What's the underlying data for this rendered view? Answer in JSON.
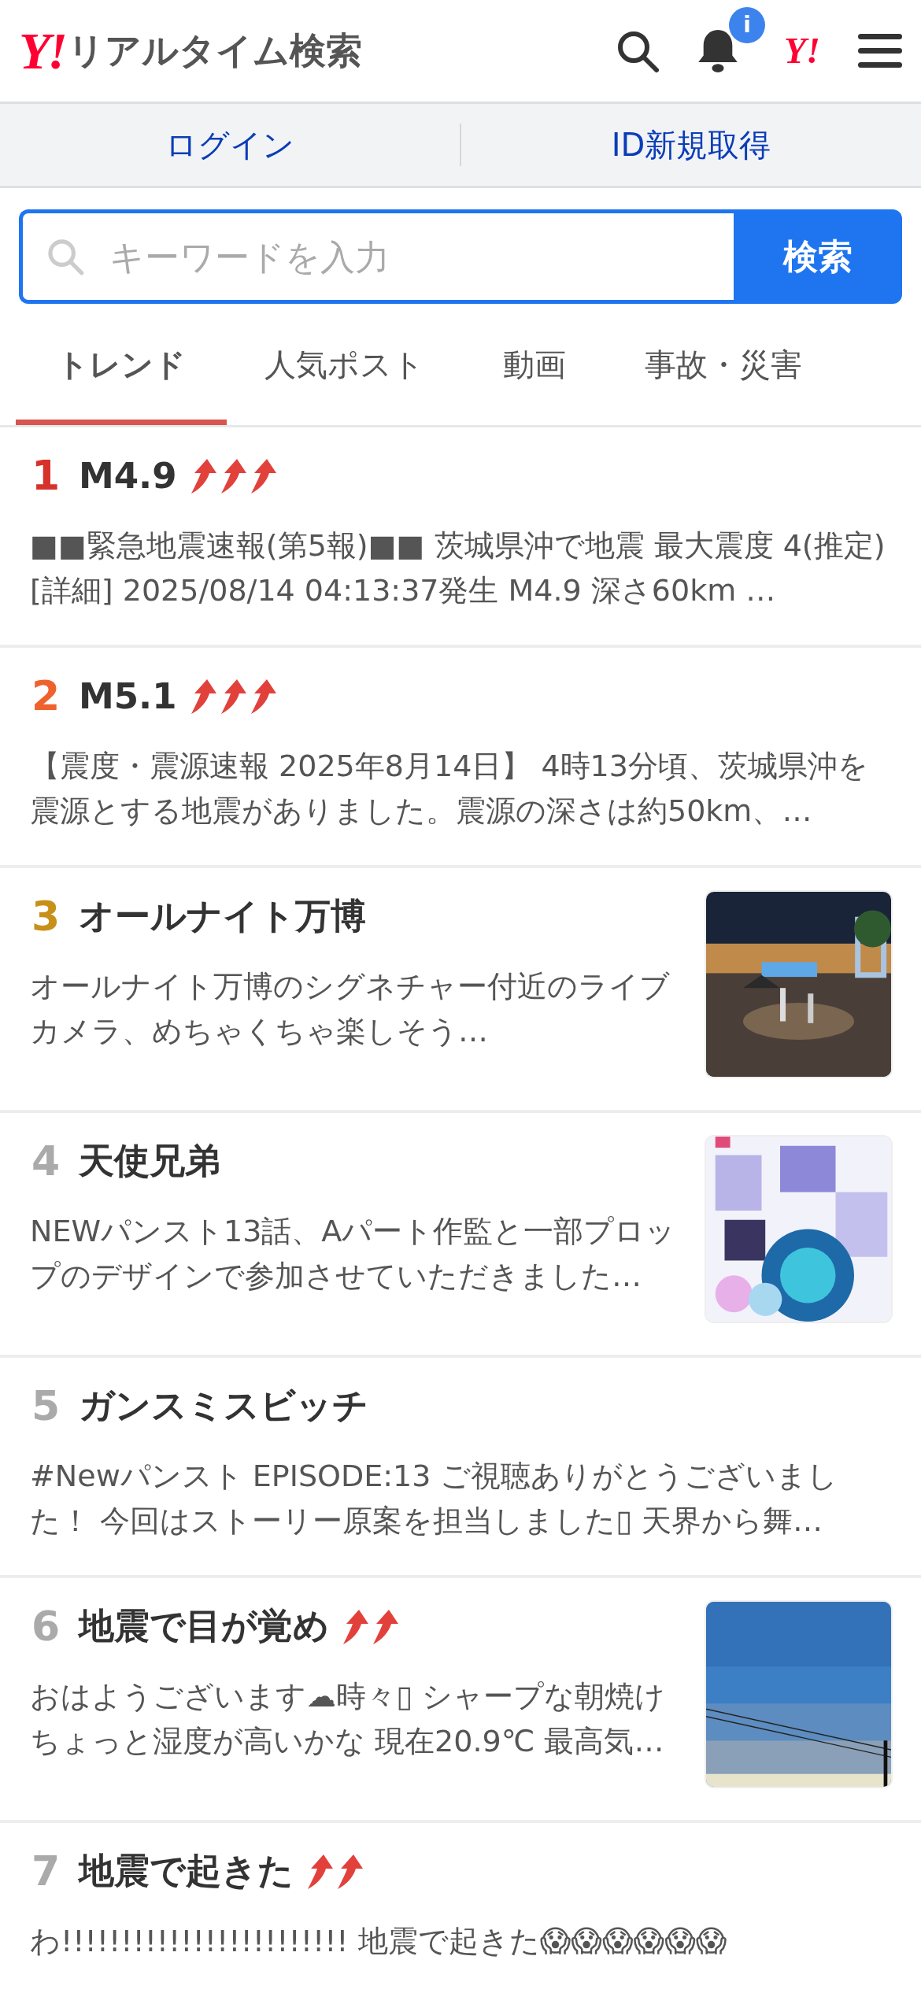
{
  "header": {
    "logo_mark": "Y!",
    "logo_title": "リアルタイム検索",
    "notification_badge": "i",
    "account_mark": "Y!"
  },
  "account_bar": {
    "links": [
      "ログイン",
      "ID新規取得"
    ]
  },
  "search": {
    "placeholder": "キーワードを入力",
    "button": "検索"
  },
  "tabs": [
    {
      "label": "トレンド",
      "selected": true
    },
    {
      "label": "人気ポスト",
      "selected": false
    },
    {
      "label": "動画",
      "selected": false
    },
    {
      "label": "事故・災害",
      "selected": false
    }
  ],
  "trends": [
    {
      "rank": "1",
      "color": "#d6322b",
      "title": "M4.9",
      "kind": "hot",
      "body": "■■緊急地震速報(第5報)■■ 茨城県沖で地震 最大震度 4(推定) [詳細] 2025/08/14 04:13:37発生 M4.9 深さ60km …"
    },
    {
      "rank": "2",
      "color": "#f0622d",
      "title": "M5.1",
      "kind": "hot",
      "body": "【震度・震源速報 2025年8月14日】 4時13分頃、茨城県沖を震源とする地震がありました。震源の深さは約50km、…"
    },
    {
      "rank": "3",
      "color": "#c8901a",
      "title": "オールナイト万博",
      "kind": "plain",
      "body": "オールナイト万博のシグネチャー付近のライブカメラ、めちゃくちゃ楽しそう…"
    },
    {
      "rank": "4",
      "color": "#aaaaaa",
      "title": "天使兄弟",
      "kind": "plain",
      "body": "NEWパンスト13話、Aパート作監と一部プロップのデザインで参加させていただきました…"
    },
    {
      "rank": "5",
      "color": "#aaaaaa",
      "title": "ガンスミスビッチ",
      "kind": "plain",
      "body": "#Newパンスト EPISODE:13 ご視聴ありがとうございました！ 今回はストーリー原案を担当しました▯ 天界から舞…"
    },
    {
      "rank": "6",
      "color": "#aaaaaa",
      "title": "地震で目が覚め",
      "kind": "rising",
      "body": "おはようございます☁時々▯ シャープな朝焼けちょっと湿度が高いかな 現在20.9℃ 最高気…"
    },
    {
      "rank": "7",
      "color": "#aaaaaa",
      "title": "地震で起きた",
      "kind": "rising",
      "body": "わ!!!!!!!!!!!!!!!!!!!!!!!! 地震で起きた😱😱😱😱😱😱"
    }
  ]
}
